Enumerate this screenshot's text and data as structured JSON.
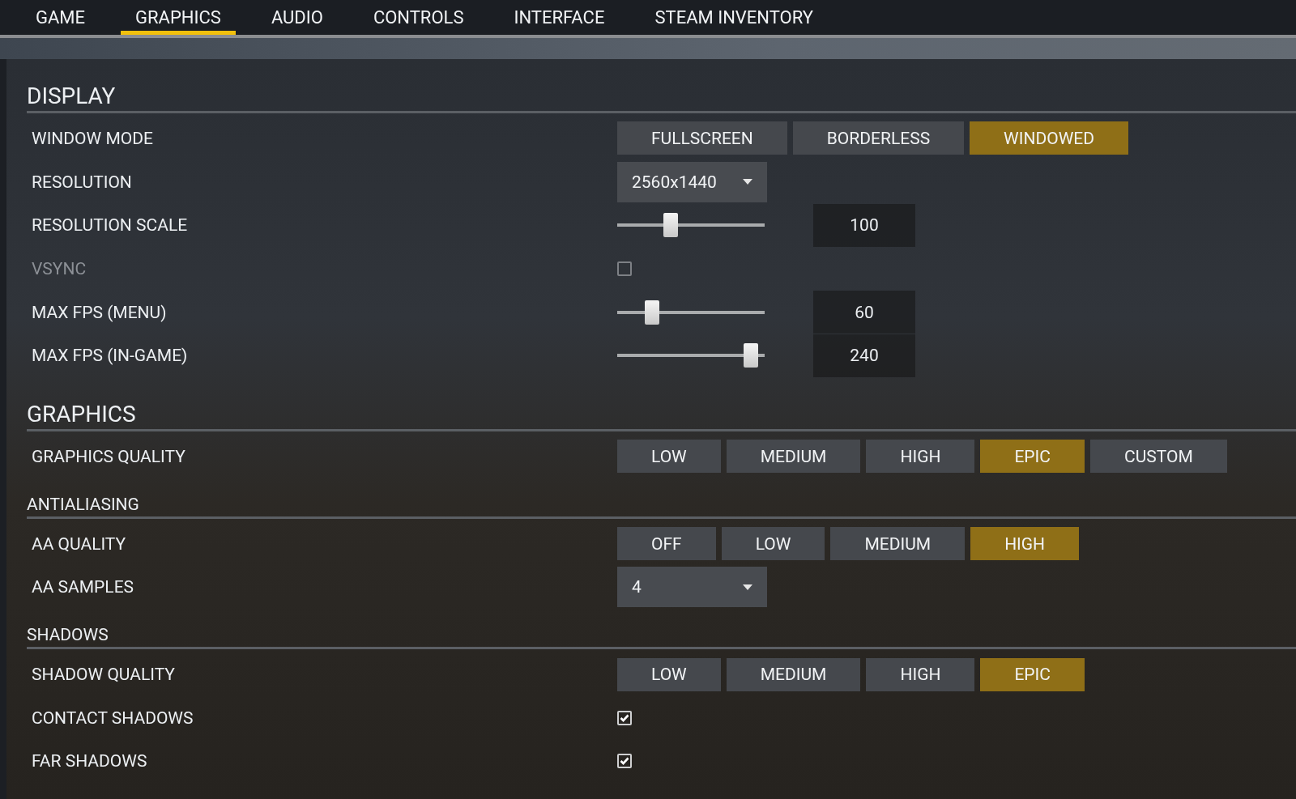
{
  "tabs": [
    {
      "label": "GAME",
      "selected": false
    },
    {
      "label": "GRAPHICS",
      "selected": true
    },
    {
      "label": "AUDIO",
      "selected": false
    },
    {
      "label": "CONTROLS",
      "selected": false
    },
    {
      "label": "INTERFACE",
      "selected": false
    },
    {
      "label": "STEAM INVENTORY",
      "selected": false
    }
  ],
  "sections": [
    {
      "title": "DISPLAY",
      "kind": "major",
      "rows": [
        {
          "label": "WINDOW MODE",
          "kind": "segmented",
          "disabled": false,
          "options": [
            {
              "label": "FULLSCREEN",
              "selected": false
            },
            {
              "label": "BORDERLESS",
              "selected": false
            },
            {
              "label": "WINDOWED",
              "selected": true
            }
          ]
        },
        {
          "label": "RESOLUTION",
          "kind": "dropdown",
          "disabled": false,
          "value": "2560x1440"
        },
        {
          "label": "RESOLUTION SCALE",
          "kind": "slider",
          "disabled": false,
          "level": 0.35,
          "reading": "100"
        },
        {
          "label": "VSYNC",
          "kind": "checkbox",
          "disabled": true,
          "checked": false
        },
        {
          "label": "MAX FPS (MENU)",
          "kind": "slider",
          "disabled": false,
          "level": 0.21,
          "reading": "60"
        },
        {
          "label": "MAX FPS (IN-GAME)",
          "kind": "slider",
          "disabled": false,
          "level": 0.95,
          "reading": "240"
        }
      ]
    },
    {
      "title": "GRAPHICS",
      "kind": "major",
      "rows": [
        {
          "label": "GRAPHICS QUALITY",
          "kind": "segmented",
          "disabled": false,
          "options": [
            {
              "label": "LOW",
              "selected": false
            },
            {
              "label": "MEDIUM",
              "selected": false
            },
            {
              "label": "HIGH",
              "selected": false
            },
            {
              "label": "EPIC",
              "selected": true
            },
            {
              "label": "CUSTOM",
              "selected": false
            }
          ]
        }
      ]
    },
    {
      "title": "ANTIALIASING",
      "kind": "minor",
      "rows": [
        {
          "label": "AA QUALITY",
          "kind": "segmented",
          "disabled": false,
          "options": [
            {
              "label": "OFF",
              "selected": false
            },
            {
              "label": "LOW",
              "selected": false
            },
            {
              "label": "MEDIUM",
              "selected": false
            },
            {
              "label": "HIGH",
              "selected": true
            }
          ]
        },
        {
          "label": "AA SAMPLES",
          "kind": "dropdown",
          "disabled": false,
          "value": "4"
        }
      ]
    },
    {
      "title": "SHADOWS",
      "kind": "minor",
      "rows": [
        {
          "label": "SHADOW QUALITY",
          "kind": "segmented",
          "disabled": false,
          "options": [
            {
              "label": "LOW",
              "selected": false
            },
            {
              "label": "MEDIUM",
              "selected": false
            },
            {
              "label": "HIGH",
              "selected": false
            },
            {
              "label": "EPIC",
              "selected": true
            }
          ]
        },
        {
          "label": "CONTACT SHADOWS",
          "kind": "checkbox",
          "disabled": false,
          "checked": true
        },
        {
          "label": "FAR SHADOWS",
          "kind": "checkbox",
          "disabled": false,
          "checked": true
        }
      ]
    }
  ]
}
